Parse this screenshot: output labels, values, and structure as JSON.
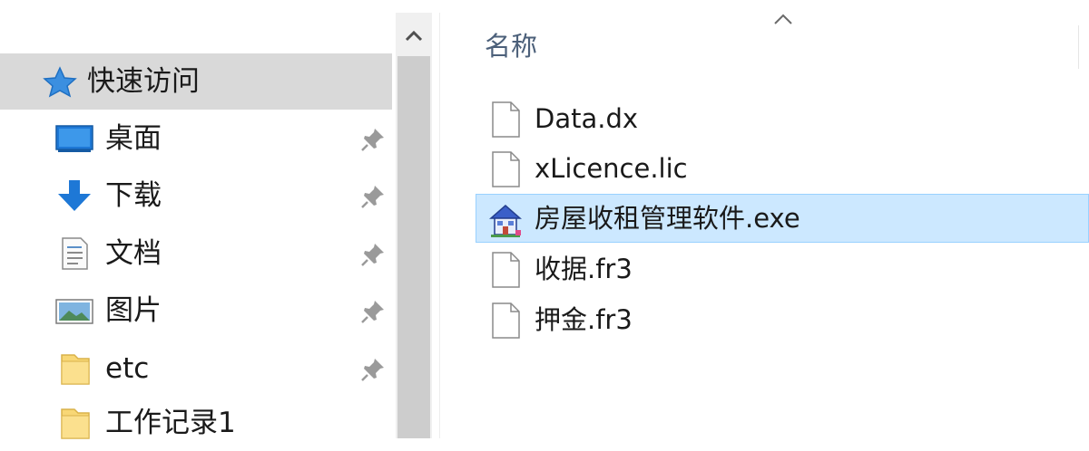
{
  "nav": {
    "items": [
      {
        "label": "快速访问",
        "icon": "quick-access-star-icon",
        "pinned": false,
        "selected": true
      },
      {
        "label": "桌面",
        "icon": "desktop-icon",
        "pinned": true,
        "selected": false
      },
      {
        "label": "下载",
        "icon": "download-arrow-icon",
        "pinned": true,
        "selected": false
      },
      {
        "label": "文档",
        "icon": "document-icon",
        "pinned": true,
        "selected": false
      },
      {
        "label": "图片",
        "icon": "pictures-icon",
        "pinned": true,
        "selected": false
      },
      {
        "label": "etc",
        "icon": "folder-icon",
        "pinned": true,
        "selected": false
      },
      {
        "label": "工作记录1",
        "icon": "folder-icon",
        "pinned": false,
        "selected": false
      }
    ]
  },
  "list": {
    "column_name": "名称",
    "sort": "ascending",
    "files": [
      {
        "name": "Data.dx",
        "icon": "file-icon",
        "selected": false
      },
      {
        "name": "xLicence.lic",
        "icon": "file-icon",
        "selected": false
      },
      {
        "name": "房屋收租管理软件.exe",
        "icon": "house-app-icon",
        "selected": true
      },
      {
        "name": "收据.fr3",
        "icon": "file-icon",
        "selected": false
      },
      {
        "name": "押金.fr3",
        "icon": "file-icon",
        "selected": false
      }
    ]
  },
  "colors": {
    "selected_nav": "#d9d9d9",
    "selected_file": "#cce8ff",
    "selected_file_border": "#99d1ff",
    "accent_blue": "#1e78d6",
    "folder_yellow": "#f8d775",
    "header_text": "#4c607a"
  }
}
